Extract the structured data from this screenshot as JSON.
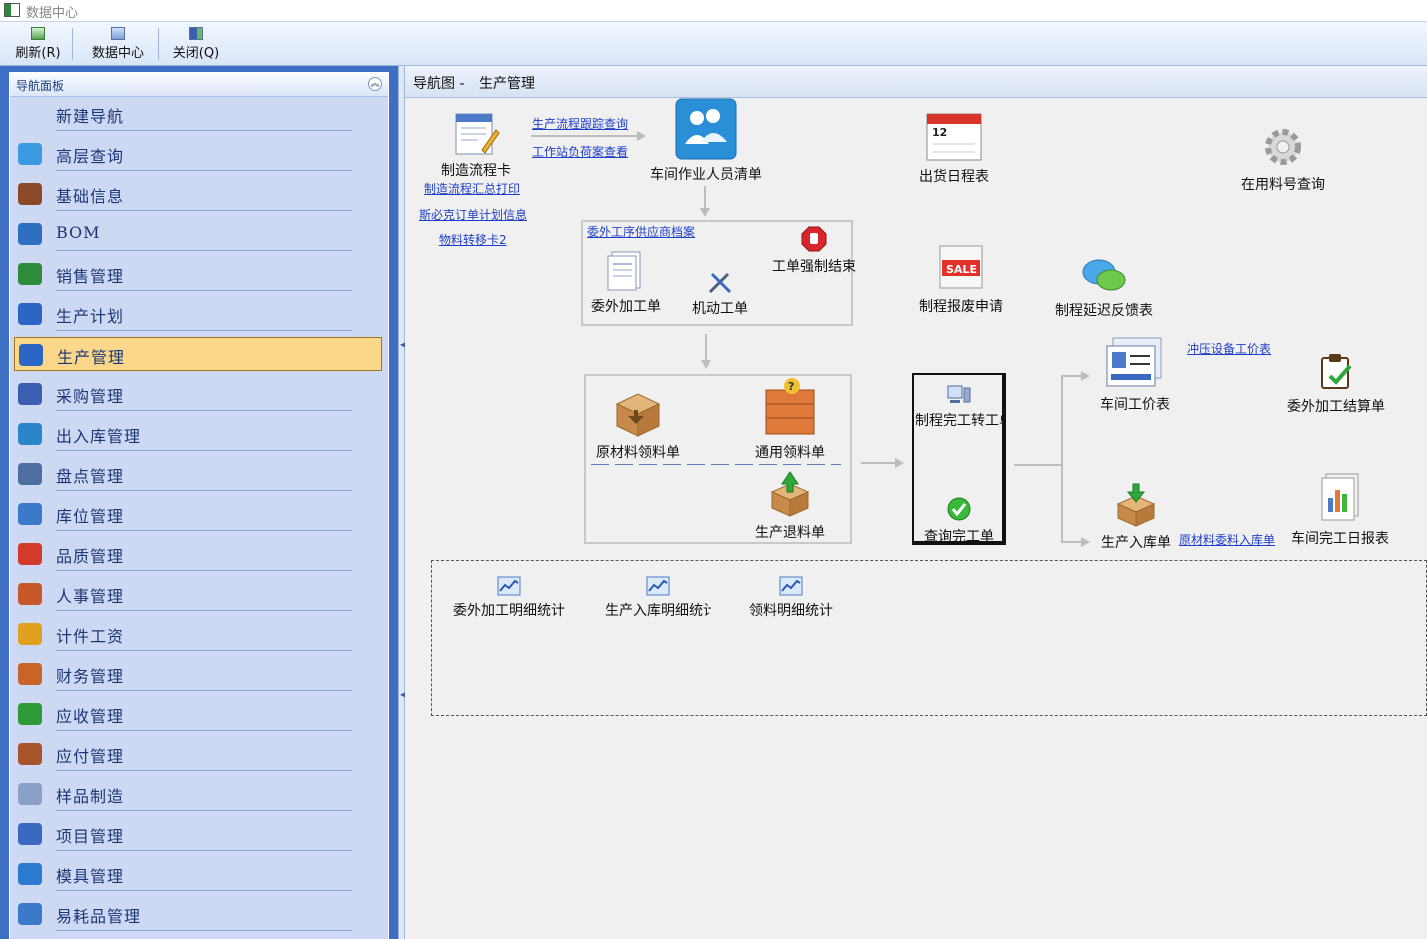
{
  "window": {
    "title": "数据中心"
  },
  "toolbar": {
    "refresh": "刷新(R)",
    "datacenter": "数据中心",
    "close": "关闭(Q)"
  },
  "nav": {
    "title": "导航面板",
    "items": [
      {
        "label": "新建导航",
        "color": ""
      },
      {
        "label": "高层查询",
        "color": "#3c9ae0"
      },
      {
        "label": "基础信息",
        "color": "#8a4a2a"
      },
      {
        "label": "BOM",
        "color": "#2f6fc0"
      },
      {
        "label": "销售管理",
        "color": "#2e8b3a"
      },
      {
        "label": "生产计划",
        "color": "#2b66c4"
      },
      {
        "label": "生产管理",
        "color": "#2b66c4"
      },
      {
        "label": "采购管理",
        "color": "#3a5fb0"
      },
      {
        "label": "出入库管理",
        "color": "#2a86c8"
      },
      {
        "label": "盘点管理",
        "color": "#4d6fa0"
      },
      {
        "label": "库位管理",
        "color": "#3a7ac8"
      },
      {
        "label": "品质管理",
        "color": "#d23a2a"
      },
      {
        "label": "人事管理",
        "color": "#c8582a"
      },
      {
        "label": "计件工资",
        "color": "#e0a020"
      },
      {
        "label": "财务管理",
        "color": "#c86428"
      },
      {
        "label": "应收管理",
        "color": "#2e9a3a"
      },
      {
        "label": "应付管理",
        "color": "#a8542a"
      },
      {
        "label": "样品制造",
        "color": "#8aa0c8"
      },
      {
        "label": "项目管理",
        "color": "#3a6ac0"
      },
      {
        "label": "模具管理",
        "color": "#2a7ad0"
      },
      {
        "label": "易耗品管理",
        "color": "#3a7ac8"
      }
    ]
  },
  "main": {
    "crumb_root": "导航图 -",
    "crumb_page": "生产管理",
    "nodes": {
      "card": "制造流程卡",
      "staff": "车间作业人员清单",
      "shipping": "出货日程表",
      "material_query": "在用料号查询",
      "outsource_order": "委外加工单",
      "mobile_order": "机动工单",
      "force_close": "工单强制结束",
      "scrap": "制程报废申请单",
      "delay": "制程延迟反馈表",
      "raw_pick": "原材料领料单",
      "general_pick": "通用领料单",
      "return": "生产退料单",
      "transfer": "制程完工转工单",
      "query_done": "查询完工单",
      "wage": "车间工价表",
      "outsource_settle": "委外加工结算单",
      "stock_in": "生产入库单",
      "daily": "车间完工日报表",
      "stat_outsource": "委外加工明细统计",
      "stat_stockin": "生产入库明细统计",
      "stat_pick": "领料明细统计"
    },
    "links": {
      "trace": "生产流程跟踪查询",
      "station": "工作站负荷案查看",
      "summary_print": "制造流程汇总打印",
      "plan_info": "斯必克订单计划信息",
      "card2": "物料转移卡2",
      "vendor": "委外工序供应商档案",
      "press_price": "冲压设备工价表",
      "raw_in": "原材料委料入库单"
    }
  }
}
